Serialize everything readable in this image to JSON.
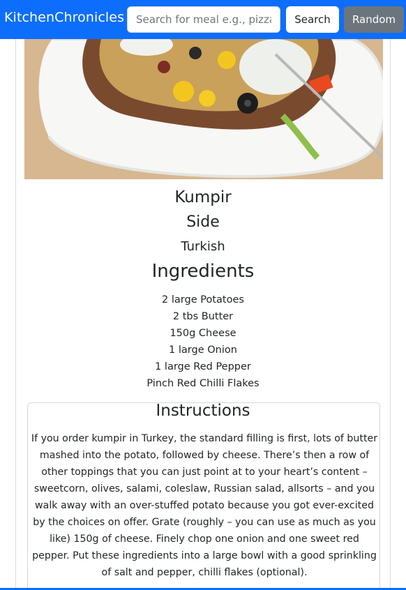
{
  "navbar": {
    "brand": "KitchenChronicles",
    "search_placeholder": "Search for meal e.g., pizza",
    "search_value": "",
    "search_label": "Search",
    "random_label": "Random"
  },
  "meal": {
    "name": "Kumpir",
    "category": "Side",
    "area": "Turkish",
    "ingredients_title": "Ingredients",
    "ingredients": [
      "2 large Potatoes",
      "2 tbs Butter",
      "150g Cheese",
      "1 large Onion",
      "1 large Red Pepper",
      "Pinch Red Chilli Flakes"
    ],
    "instructions_title": "Instructions",
    "instructions": "If you order kumpir in Turkey, the standard filling is first, lots of butter mashed into the potato, followed by cheese. There’s then a row of other toppings that you can just point at to your heart’s content – sweetcorn, olives, salami, coleslaw, Russian salad, allsorts – and you walk away with an over-stuffed potato because you got ever-excited by the choices on offer. Grate (roughly – you can use as much as you like) 150g of cheese. Finely chop one onion and one sweet red pepper. Put these ingredients into a large bowl with a good sprinkling of salt and pepper, chilli flakes (optional)."
  },
  "colors": {
    "primary": "#0d6efd",
    "secondary": "#6c757d"
  }
}
